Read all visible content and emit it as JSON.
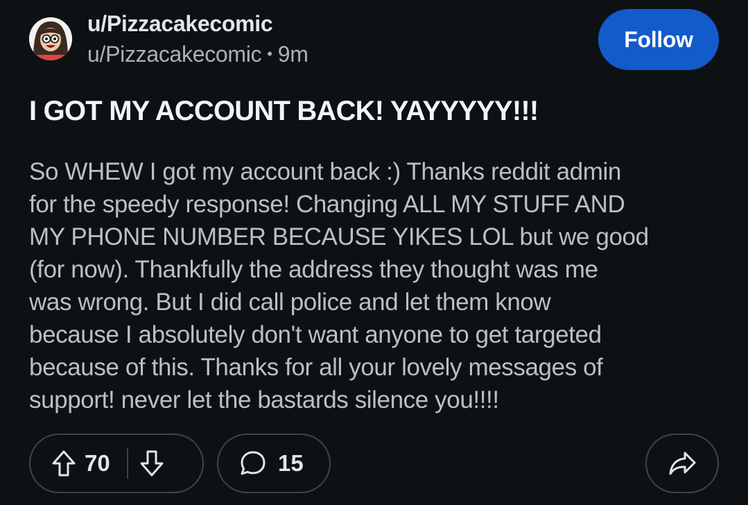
{
  "post": {
    "author_display": "u/Pizzacakecomic",
    "author_username": "u/Pizzacakecomic",
    "separator": "•",
    "time_ago": "9m",
    "follow_label": "Follow",
    "title": "I GOT MY ACCOUNT BACK! YAYYYYY!!!",
    "body_lines": [
      "So WHEW I got my account back :) Thanks reddit admin",
      "for the speedy response! Changing ALL MY STUFF AND",
      "MY PHONE NUMBER BECAUSE YIKES LOL but we good",
      "(for now). Thankfully the address they thought was me",
      "was wrong. But I did call police and let them know",
      "because I absolutely don't want anyone to get targeted",
      "because of this. Thanks for all your lovely messages of",
      "support! never let the bastards silence you!!!!"
    ]
  },
  "actions": {
    "upvote_count": "70",
    "comment_count": "15"
  },
  "colors": {
    "background": "#0e1113",
    "accent": "#115bca"
  },
  "icons": {
    "upvote": "arrow-up-outline-icon",
    "downvote": "arrow-down-outline-icon",
    "comment": "speech-bubble-icon",
    "share": "share-arrow-icon"
  }
}
